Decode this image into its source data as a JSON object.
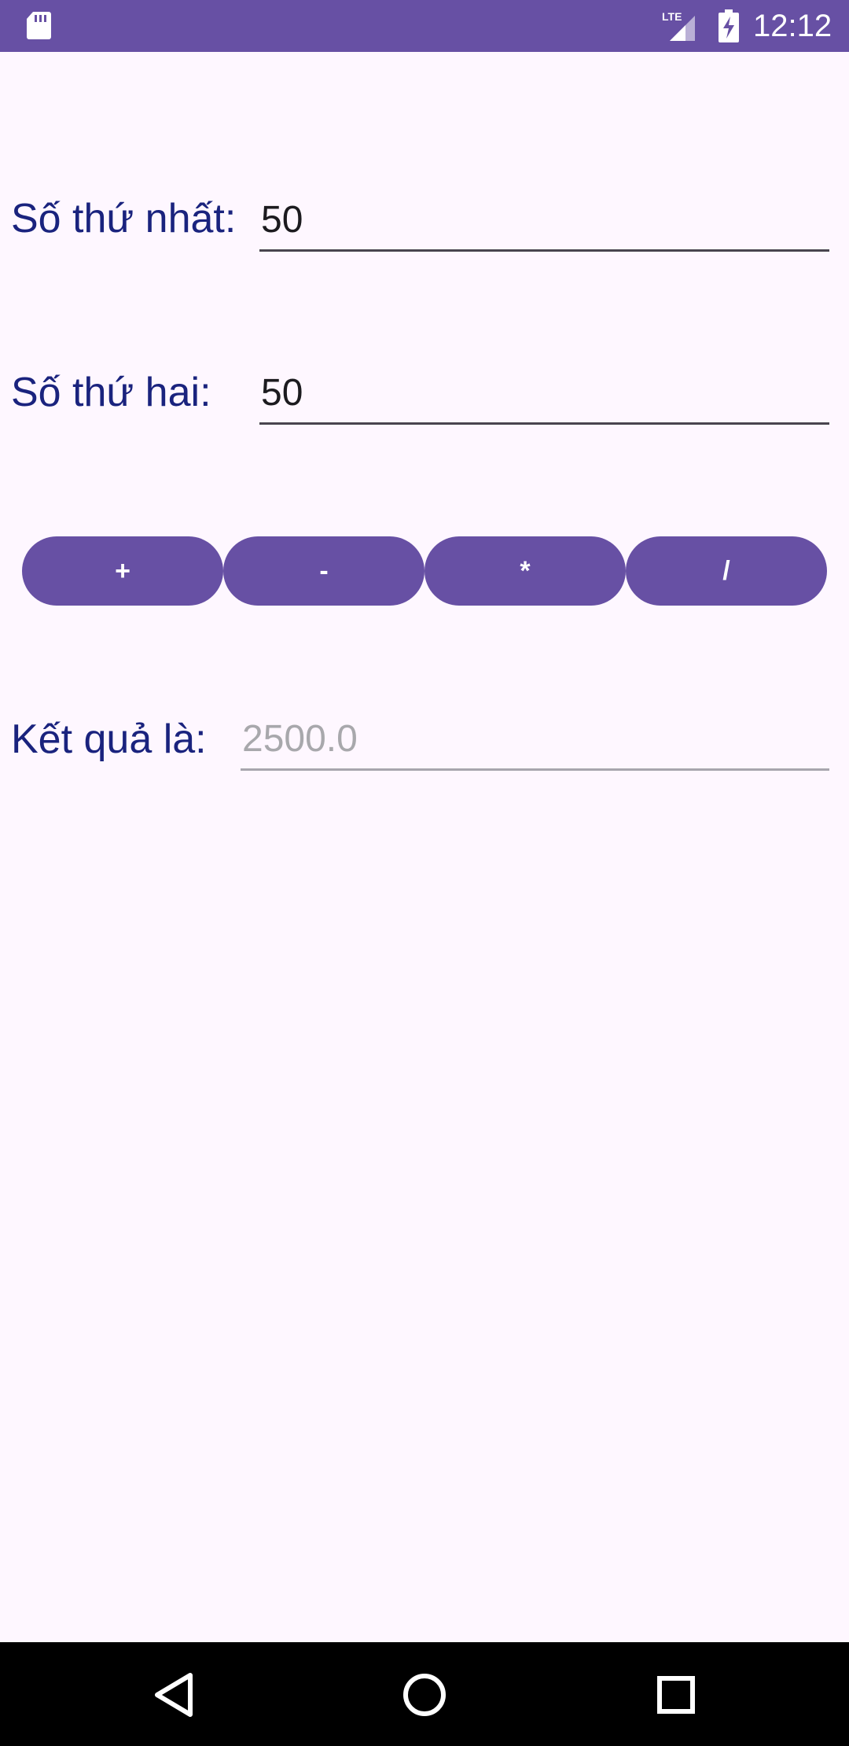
{
  "status_bar": {
    "time": "12:12",
    "network": "LTE",
    "icons": [
      "sd-card-icon",
      "lte-signal-icon",
      "battery-charging-icon"
    ],
    "background": "#6750A4"
  },
  "form": {
    "first_label": "Số thứ nhất:",
    "first_value": "50",
    "second_label": "Số thứ hai:",
    "second_value": "50",
    "result_label": "Kết quả là:",
    "result_value": "2500.0"
  },
  "operations": {
    "add": "+",
    "subtract": "-",
    "multiply": "*",
    "divide": "/"
  },
  "nav_bar": {
    "icons": [
      "back-icon",
      "home-icon",
      "recents-icon"
    ]
  },
  "colors": {
    "accent": "#6750A4",
    "label_text": "#1A237E",
    "background": "#FEF7FF"
  }
}
